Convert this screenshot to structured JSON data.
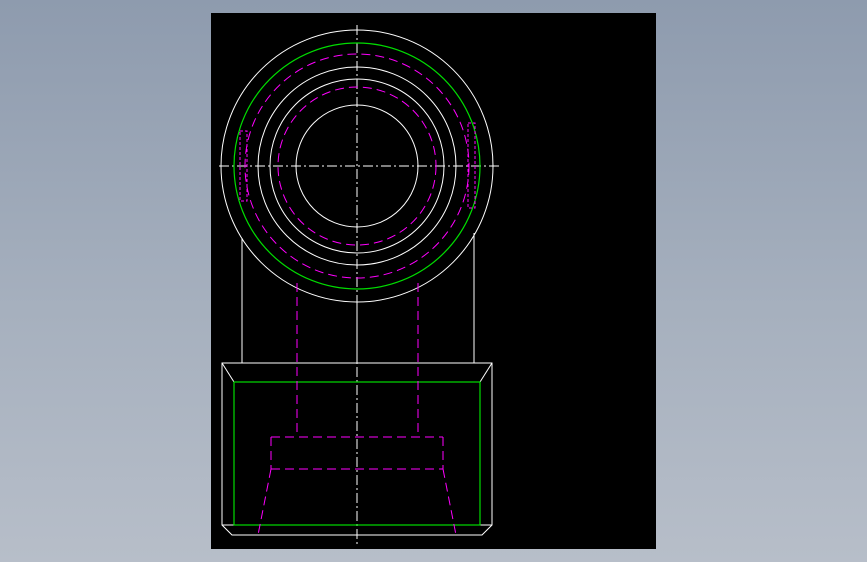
{
  "viewer": {
    "background": "#000000",
    "colors": {
      "outline": "#ffffff",
      "centerline": "#ffffff",
      "hidden": "#ff00ff",
      "thread": "#00dd00"
    }
  }
}
